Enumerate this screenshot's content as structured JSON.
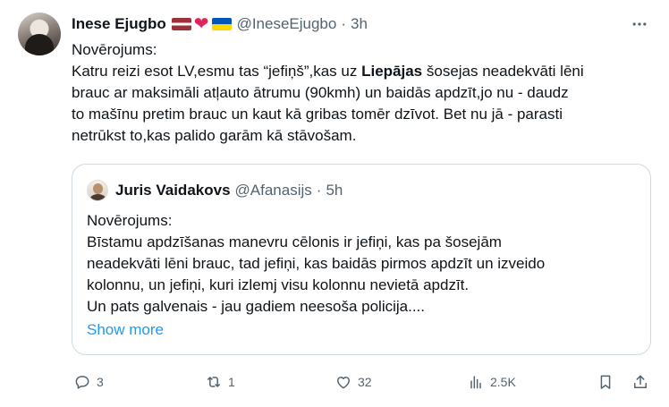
{
  "author": {
    "display_name": "Inese Ejugbo",
    "handle": "@IneseEjugbo",
    "separator": "·",
    "time": "3h",
    "flag_icons": [
      "latvia-flag-icon",
      "red-heart-icon",
      "ukraine-flag-icon"
    ]
  },
  "tweet": {
    "lines": [
      "Novērojums:",
      "Katru reizi esot LV,esmu tas “jefiņš”,kas uz ",
      "brauc ar maksimāli atļauto ātrumu (90kmh) un baidās apdzīt,jo nu - daudz",
      "to mašīnu pretim brauc un kaut kā gribas tomēr dzīvot. Bet nu jā - parasti",
      "netrūkst to,kas palido garām kā stāvošam."
    ],
    "bold_word": "Liepājas",
    "line2_tail": " šosejas neadekvāti lēni"
  },
  "quote": {
    "display_name": "Juris Vaidakovs",
    "handle": "@Afanasijs",
    "separator": "·",
    "time": "5h",
    "lines": [
      "Novērojums:",
      "Bīstamu apdzīšanas manevru cēlonis ir jefiņi, kas pa šosejām",
      "neadekvāti lēni brauc, tad jefiņi, kas baidās pirmos apdzīt un izveido",
      "kolonnu, un jefiņi, kuri izlemj visu kolonnu nevietā apdzīt.",
      "Un pats galvenais - jau gadiem neesoša policija...."
    ],
    "show_more": "Show more"
  },
  "actions": {
    "replies": "3",
    "reposts": "1",
    "likes": "32",
    "views": "2.5K"
  },
  "colors": {
    "text": "#0f1419",
    "secondary": "#536471",
    "link": "#1d9bf0",
    "border": "#cfd9de"
  }
}
